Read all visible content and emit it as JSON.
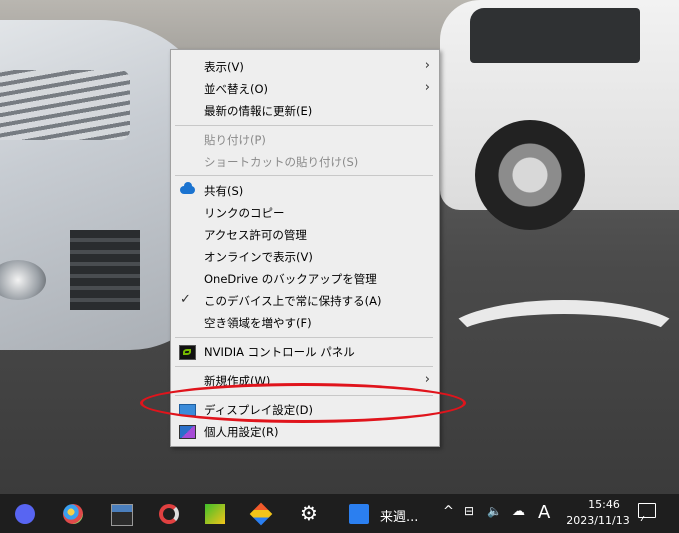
{
  "context_menu": {
    "items": [
      {
        "label": "表示(V)",
        "submenu": true
      },
      {
        "label": "並べ替え(O)",
        "submenu": true
      },
      {
        "label": "最新の情報に更新(E)"
      },
      {
        "label": "貼り付け(P)",
        "disabled": true
      },
      {
        "label": "ショートカットの貼り付け(S)",
        "disabled": true
      },
      {
        "label": "共有(S)",
        "icon": "onedrive-cloud-icon"
      },
      {
        "label": "リンクのコピー"
      },
      {
        "label": "アクセス許可の管理"
      },
      {
        "label": "オンラインで表示(V)"
      },
      {
        "label": "OneDrive のバックアップを管理"
      },
      {
        "label": "このデバイス上で常に保持する(A)",
        "icon": "checkmark-icon"
      },
      {
        "label": "空き領域を増やす(F)"
      },
      {
        "label": "NVIDIA コントロール パネル",
        "icon": "nvidia-icon"
      },
      {
        "label": "新規作成(W)",
        "submenu": true
      },
      {
        "label": "ディスプレイ設定(D)",
        "icon": "display-settings-icon",
        "highlighted": true
      },
      {
        "label": "個人用設定(R)",
        "icon": "personalize-icon"
      }
    ]
  },
  "annotation": {
    "color": "#e0141c"
  },
  "taskbar": {
    "app_label": "来週...",
    "tray": {
      "chevron": "^",
      "ime": "A"
    },
    "clock": {
      "time": "15:46",
      "date": "2023/11/13"
    }
  }
}
